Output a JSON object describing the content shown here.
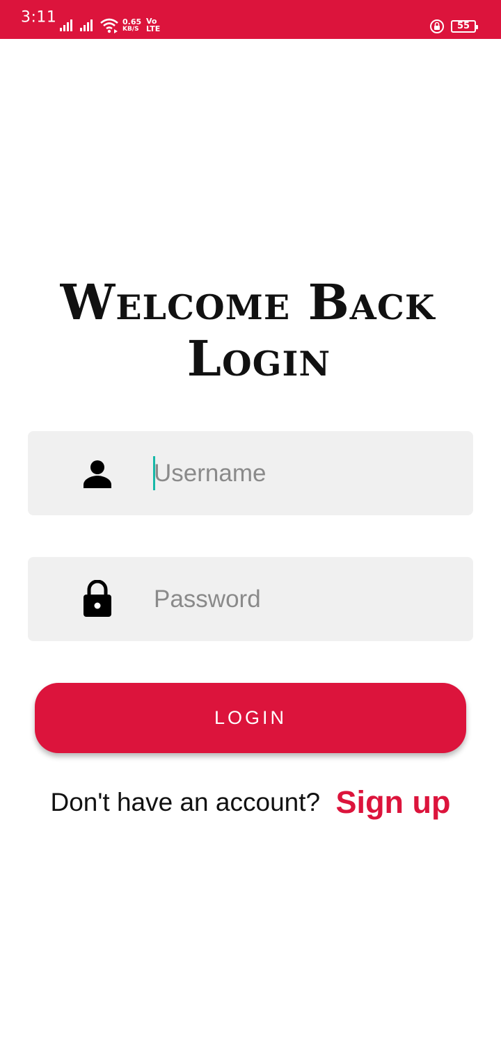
{
  "status_bar": {
    "time": "3:11",
    "speed_value": "0.65",
    "speed_unit": "KB/S",
    "volte_top": "Vo",
    "volte_bottom": "LTE",
    "battery_level": "55",
    "icons": [
      "signal-icon",
      "signal-icon",
      "wifi-icon",
      "rotation-lock-icon",
      "battery-icon"
    ],
    "background_color": "#dc143c"
  },
  "headline": {
    "line1": "Welcome Back",
    "line2": "Login"
  },
  "form": {
    "username": {
      "placeholder": "Username",
      "value": "",
      "icon": "person-icon"
    },
    "password": {
      "placeholder": "Password",
      "value": "",
      "icon": "lock-icon"
    },
    "login_label": "LOGIN"
  },
  "signup": {
    "prompt": "Don't have an account?",
    "link_label": "Sign up"
  },
  "colors": {
    "accent": "#dc143c",
    "field_background": "#f0f0f0",
    "cursor": "#17b8a8"
  }
}
